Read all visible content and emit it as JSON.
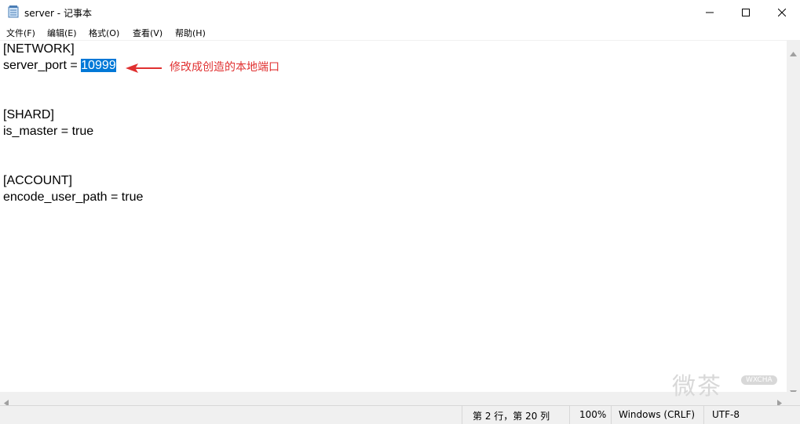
{
  "window": {
    "title": "server - 记事本",
    "icon": "notepad-icon",
    "controls": [
      "minimize-icon",
      "maximize-icon",
      "close-icon"
    ]
  },
  "menu": {
    "items": [
      {
        "label": "文件(F)"
      },
      {
        "label": "编辑(E)"
      },
      {
        "label": "格式(O)"
      },
      {
        "label": "查看(V)"
      },
      {
        "label": "帮助(H)"
      }
    ]
  },
  "editor": {
    "lines": [
      "[NETWORK]",
      "server_port = ",
      "",
      "",
      "[SHARD]",
      "is_master = true",
      "",
      "",
      "[ACCOUNT]",
      "encode_user_path = true"
    ],
    "selected_text": "10999",
    "selection_color": "#0078d7"
  },
  "annotation": {
    "text": "修改成创造的本地端口",
    "color": "#e03030"
  },
  "status": {
    "position": "第 2 行，第 20 列",
    "zoom": "100%",
    "line_ending": "Windows (CRLF)",
    "encoding": "UTF-8"
  },
  "watermark": {
    "text": "微茶",
    "badge": "WXCHA"
  }
}
